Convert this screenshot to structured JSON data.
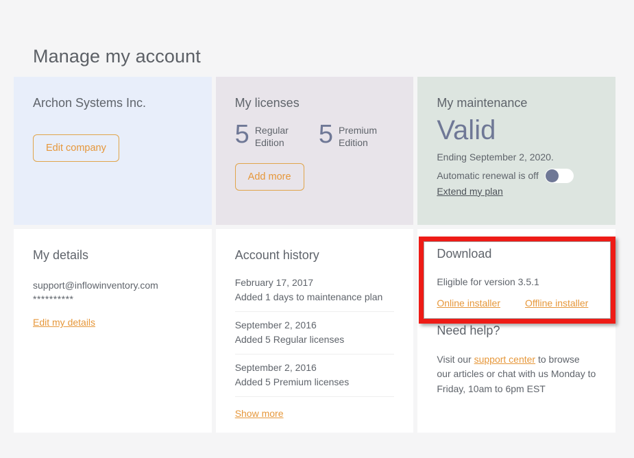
{
  "page": {
    "title": "Manage my account",
    "background": "#f5f5f6"
  },
  "colors": {
    "card_blue": "#e8eefa",
    "card_purple": "#e8e4ea",
    "card_green": "#dde5e0",
    "accent_orange": "#e6973a",
    "slate": "#6f7896",
    "annotation_red": "#ee1b16"
  },
  "company_card": {
    "name": "Archon Systems Inc.",
    "edit_button": "Edit company"
  },
  "licenses_card": {
    "title": "My licenses",
    "items": [
      {
        "count": "5",
        "label": "Regular\nEdition"
      },
      {
        "count": "5",
        "label": "Premium\nEdition"
      }
    ],
    "add_button": "Add more"
  },
  "maintenance_card": {
    "title": "My maintenance",
    "status": "Valid",
    "ending": "Ending September 2, 2020.",
    "renewal_text": "Automatic renewal is off",
    "renewal_on": false,
    "extend_link": "Extend my plan"
  },
  "details_card": {
    "title": "My details",
    "email": "support@inflowinventory.com",
    "password_mask": "**********",
    "edit_link": "Edit my details"
  },
  "history_card": {
    "title": "Account history",
    "entries": [
      {
        "date": "February 17, 2017",
        "description": "Added 1 days to maintenance plan"
      },
      {
        "date": "September 2, 2016",
        "description": "Added 5 Regular licenses"
      },
      {
        "date": "September 2, 2016",
        "description": "Added 5 Premium licenses"
      }
    ],
    "show_more": "Show more"
  },
  "download_card": {
    "title": "Download",
    "eligible": "Eligible for version 3.5.1",
    "online_installer": "Online installer",
    "offline_installer": "Offline installer"
  },
  "help_card": {
    "title": "Need help?",
    "text_before_link": "Visit our ",
    "link": "support center",
    "text_after_link": " to browse our articles or chat with us Monday to Friday, 10am to 6pm EST"
  }
}
